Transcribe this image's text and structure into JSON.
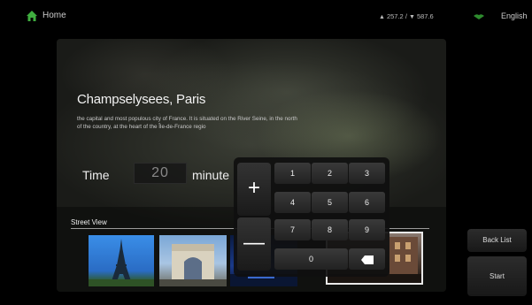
{
  "topbar": {
    "home_label": "Home",
    "traffic_up": "257.2",
    "traffic_sep": "/",
    "traffic_down": "587.6",
    "language": "English",
    "accent_color": "#3fae3f"
  },
  "place": {
    "title": "Champselysees, Paris",
    "description": "the capital and most populous city of France. It is situated on the River Seine, in the north of the country, at the heart of the Île-de-France regio"
  },
  "time": {
    "label": "Time",
    "value": "20",
    "unit": "minute"
  },
  "street_view": {
    "label": "Street View",
    "thumbnails": [
      "eiffel-tower",
      "arc-de-triomphe",
      "night-city",
      "building-street"
    ]
  },
  "keypad": {
    "plus": "+",
    "minus": "—",
    "keys": [
      "1",
      "2",
      "3",
      "4",
      "5",
      "6",
      "7",
      "8",
      "9"
    ],
    "zero": "0",
    "backspace_icon": "backspace-icon"
  },
  "buttons": {
    "back_list": "Back List",
    "start": "Start"
  }
}
